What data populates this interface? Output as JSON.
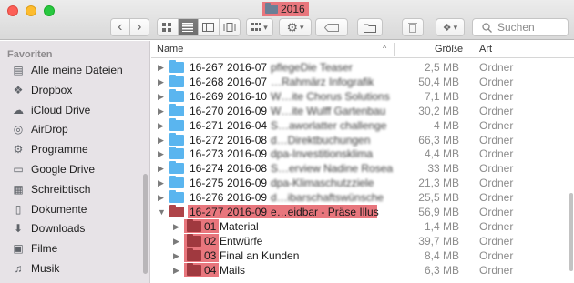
{
  "window": {
    "title": "2016"
  },
  "toolbar": {
    "back": "‹",
    "forward": "›",
    "view_buttons": [
      "icon-view",
      "list-view",
      "column-view",
      "coverflow-view"
    ],
    "arrange_label": "▾",
    "action_label": "▾",
    "share_label": "▾",
    "search_placeholder": "Suchen"
  },
  "sidebar": {
    "header": "Favoriten",
    "items": [
      {
        "label": "Alle meine Dateien",
        "icon": "all-files-icon"
      },
      {
        "label": "Dropbox",
        "icon": "dropbox-icon"
      },
      {
        "label": "iCloud Drive",
        "icon": "cloud-icon"
      },
      {
        "label": "AirDrop",
        "icon": "airdrop-icon"
      },
      {
        "label": "Programme",
        "icon": "apps-icon"
      },
      {
        "label": "Google Drive",
        "icon": "folder-icon"
      },
      {
        "label": "Schreibtisch",
        "icon": "desktop-icon"
      },
      {
        "label": "Dokumente",
        "icon": "documents-icon"
      },
      {
        "label": "Downloads",
        "icon": "downloads-icon"
      },
      {
        "label": "Filme",
        "icon": "movies-icon"
      },
      {
        "label": "Musik",
        "icon": "music-icon"
      }
    ]
  },
  "columns": {
    "name": "Name",
    "size": "Größe",
    "kind": "Art"
  },
  "rows": [
    {
      "num": "16-267",
      "date": "2016-07",
      "desc": "pflegeDie Teaser",
      "size": "2,5 MB",
      "kind": "Ordner"
    },
    {
      "num": "16-268",
      "date": "2016-07",
      "desc": "…Rahmärz Infografik",
      "size": "50,4 MB",
      "kind": "Ordner"
    },
    {
      "num": "16-269",
      "date": "2016-10",
      "desc": "W…ite Chorus Solutions",
      "size": "7,1 MB",
      "kind": "Ordner"
    },
    {
      "num": "16-270",
      "date": "2016-09",
      "desc": "W…ite Wulff Gartenbau",
      "size": "30,2 MB",
      "kind": "Ordner"
    },
    {
      "num": "16-271",
      "date": "2016-04",
      "desc": "S…aworlatter challenge",
      "size": "4 MB",
      "kind": "Ordner"
    },
    {
      "num": "16-272",
      "date": "2016-08",
      "desc": "d…Direktbuchungen",
      "size": "66,3 MB",
      "kind": "Ordner"
    },
    {
      "num": "16-273",
      "date": "2016-09",
      "desc": "dpa-Investitionsklima",
      "size": "4,4 MB",
      "kind": "Ordner"
    },
    {
      "num": "16-274",
      "date": "2016-08",
      "desc": "S…erview Nadine Rosea",
      "size": "33 MB",
      "kind": "Ordner"
    },
    {
      "num": "16-275",
      "date": "2016-09",
      "desc": "dpa-Klimaschutzziele",
      "size": "21,3 MB",
      "kind": "Ordner"
    },
    {
      "num": "16-276",
      "date": "2016-09",
      "desc": "d…ibarschaftswünsche",
      "size": "25,5 MB",
      "kind": "Ordner"
    },
    {
      "num": "16-277",
      "date": "2016-09",
      "desc": "e…eidbar - Präse Illus",
      "size": "56,9 MB",
      "kind": "Ordner"
    }
  ],
  "subrows": [
    {
      "num": "01",
      "label": "Material",
      "size": "1,4 MB",
      "kind": "Ordner"
    },
    {
      "num": "02",
      "label": "Entwürfe",
      "size": "39,7 MB",
      "kind": "Ordner"
    },
    {
      "num": "03",
      "label": "Final an Kunden",
      "size": "8,4 MB",
      "kind": "Ordner"
    },
    {
      "num": "04",
      "label": "Mails",
      "size": "6,3 MB",
      "kind": "Ordner"
    }
  ],
  "colors": {
    "highlight": "#e8767d",
    "folder_blue": "#5ab5ef",
    "folder_dark": "#a0393f"
  }
}
